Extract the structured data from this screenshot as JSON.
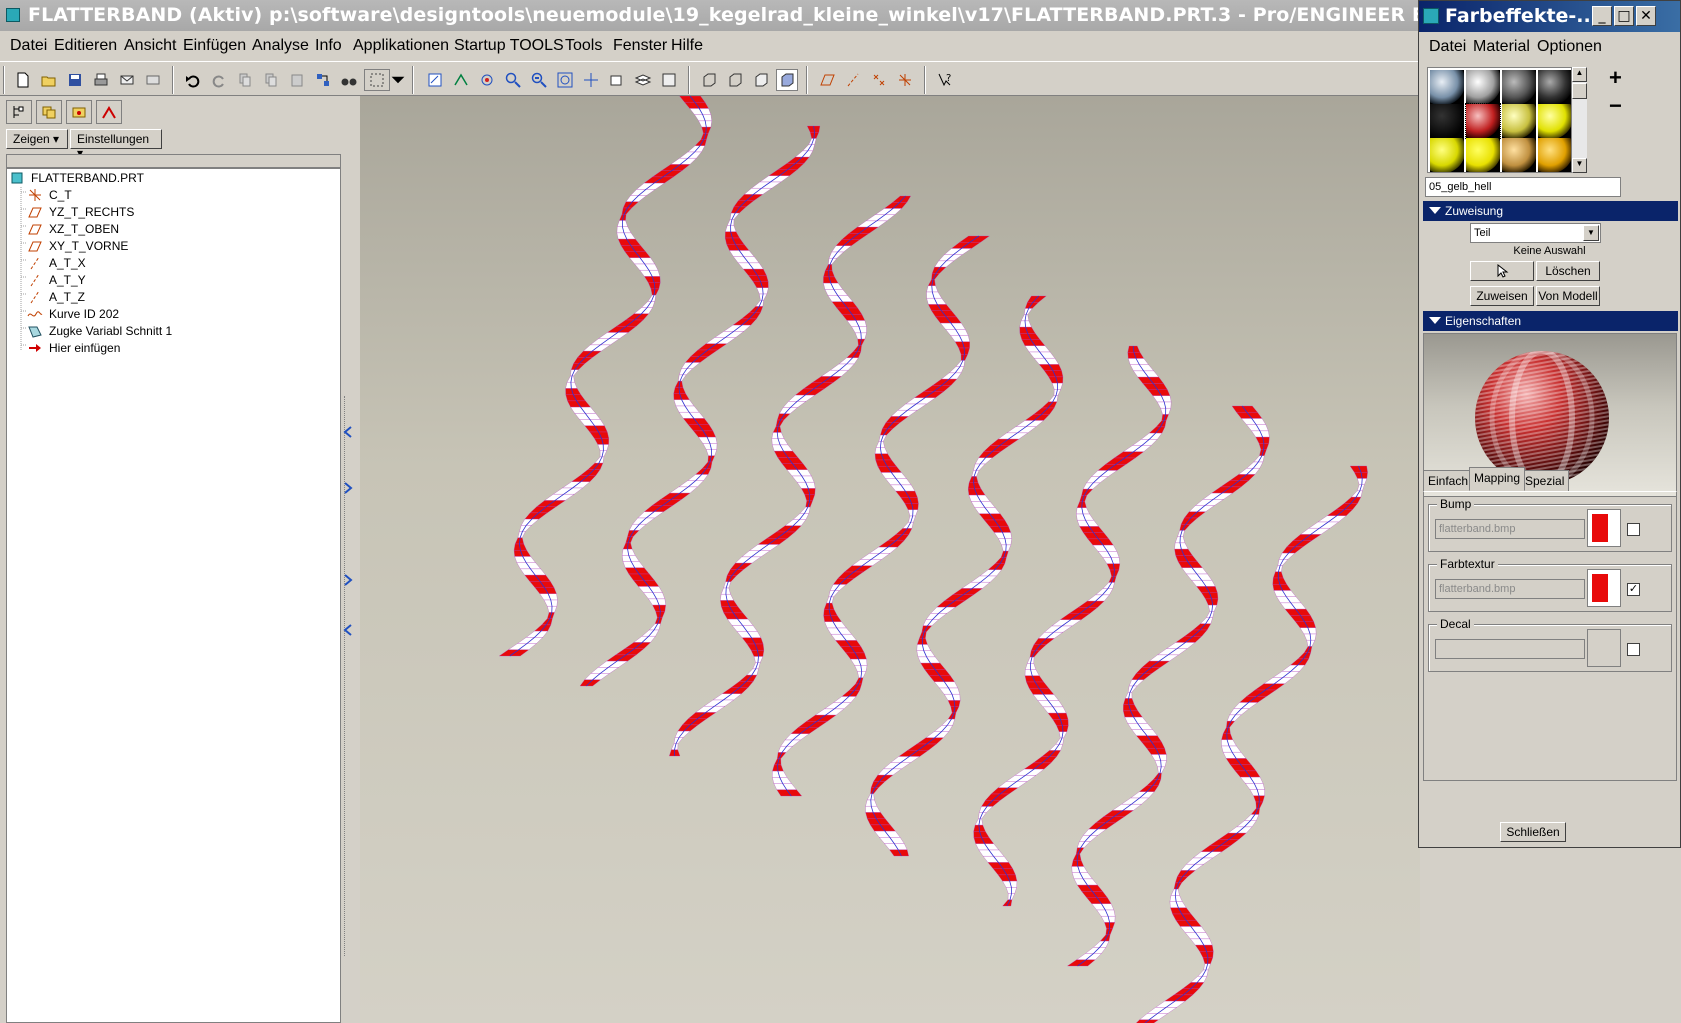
{
  "window": {
    "title": "FLATTERBAND (Aktiv) p:\\software\\designtools\\neuemodule\\19_kegelrad_kleine_winkel\\v17\\FLATTERBAND.PRT.3 - Pro/ENGINEER Education"
  },
  "menu": [
    "Datei",
    "Editieren",
    "Ansicht",
    "Einfügen",
    "Analyse",
    "Info",
    "Applikationen",
    "Startup TOOLS",
    "Tools",
    "Fenster",
    "Hilfe"
  ],
  "leftpane": {
    "show_button": "Zeigen",
    "settings_button": "Einstellungen",
    "tree": [
      {
        "label": "FLATTERBAND.PRT",
        "icon": "part-icon"
      },
      {
        "label": "C_T",
        "icon": "coordinate-system-icon"
      },
      {
        "label": "YZ_T_RECHTS",
        "icon": "datum-plane-icon"
      },
      {
        "label": "XZ_T_OBEN",
        "icon": "datum-plane-icon"
      },
      {
        "label": "XY_T_VORNE",
        "icon": "datum-plane-icon"
      },
      {
        "label": "A_T_X",
        "icon": "datum-axis-icon"
      },
      {
        "label": "A_T_Y",
        "icon": "datum-axis-icon"
      },
      {
        "label": "A_T_Z",
        "icon": "datum-axis-icon"
      },
      {
        "label": "Kurve ID 202",
        "icon": "curve-icon"
      },
      {
        "label": "Zugke Variabl Schnitt 1",
        "icon": "sweep-icon"
      },
      {
        "label": "Hier einfügen",
        "icon": "insert-arrow-icon"
      }
    ]
  },
  "dialog": {
    "title": "Farbeffekte-...",
    "menu": [
      "Datei",
      "Material",
      "Optionen"
    ],
    "material_name": "05_gelb_hell",
    "zuweisung": {
      "header": "Zuweisung",
      "scope": "Teil",
      "selection_status": "Keine Auswahl",
      "delete_button": "Löschen",
      "assign_button": "Zuweisen",
      "from_model_button": "Von Modell"
    },
    "eigenschaften": {
      "header": "Eigenschaften"
    },
    "tabs": [
      "Einfach",
      "Mapping",
      "Spezial"
    ],
    "active_tab": "Mapping",
    "bump": {
      "label": "Bump",
      "file": "flatterband.bmp",
      "checked": false
    },
    "farbtextur": {
      "label": "Farbtextur",
      "file": "flatterband.bmp",
      "checked": true
    },
    "decal": {
      "label": "Decal",
      "file": "",
      "checked": false
    },
    "close_button": "Schließen",
    "add_symbol": "+",
    "remove_symbol": "−"
  },
  "colors": {
    "ribbon_red": "#e80a0a",
    "ribbon_white": "#ffffff",
    "selection_blue": "#0a246a"
  }
}
